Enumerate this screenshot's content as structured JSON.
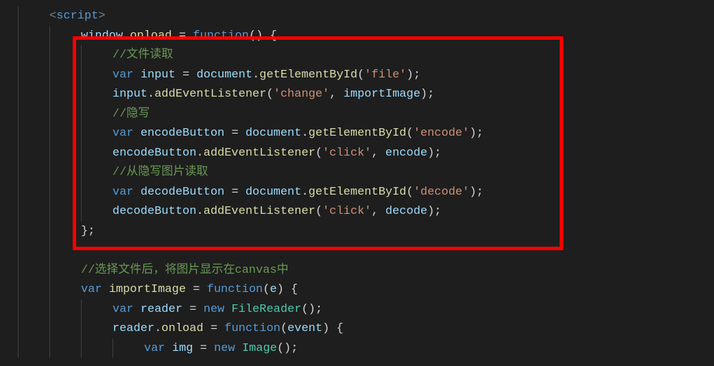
{
  "lines": [
    {
      "indent": 1,
      "tokens": [
        [
          "<",
          "t-angle"
        ],
        [
          "script",
          "t-tag"
        ],
        [
          ">",
          "t-angle"
        ]
      ]
    },
    {
      "indent": 2,
      "tokens": [
        [
          "window",
          "t-obj"
        ],
        [
          ".",
          "t-punc"
        ],
        [
          "onload",
          "t-fn"
        ],
        [
          " ",
          "t-punc"
        ],
        [
          "=",
          "t-punc"
        ],
        [
          " ",
          "t-punc"
        ],
        [
          "function",
          "t-kw"
        ],
        [
          "() {",
          "t-punc"
        ]
      ]
    },
    {
      "indent": 3,
      "tokens": [
        [
          "//文件读取",
          "t-com"
        ]
      ]
    },
    {
      "indent": 3,
      "tokens": [
        [
          "var",
          "t-kw"
        ],
        [
          " ",
          "t-punc"
        ],
        [
          "input",
          "t-var"
        ],
        [
          " ",
          "t-punc"
        ],
        [
          "=",
          "t-punc"
        ],
        [
          " ",
          "t-punc"
        ],
        [
          "document",
          "t-obj"
        ],
        [
          ".",
          "t-punc"
        ],
        [
          "getElementById",
          "t-fn"
        ],
        [
          "(",
          "t-punc"
        ],
        [
          "'file'",
          "t-str"
        ],
        [
          ");",
          "t-punc"
        ]
      ]
    },
    {
      "indent": 3,
      "tokens": [
        [
          "input",
          "t-obj"
        ],
        [
          ".",
          "t-punc"
        ],
        [
          "addEventListener",
          "t-fn"
        ],
        [
          "(",
          "t-punc"
        ],
        [
          "'change'",
          "t-str"
        ],
        [
          ", ",
          "t-punc"
        ],
        [
          "importImage",
          "t-var"
        ],
        [
          ");",
          "t-punc"
        ]
      ]
    },
    {
      "indent": 3,
      "tokens": [
        [
          "//隐写",
          "t-com"
        ]
      ]
    },
    {
      "indent": 3,
      "tokens": [
        [
          "var",
          "t-kw"
        ],
        [
          " ",
          "t-punc"
        ],
        [
          "encodeButton",
          "t-var"
        ],
        [
          " ",
          "t-punc"
        ],
        [
          "=",
          "t-punc"
        ],
        [
          " ",
          "t-punc"
        ],
        [
          "document",
          "t-obj"
        ],
        [
          ".",
          "t-punc"
        ],
        [
          "getElementById",
          "t-fn"
        ],
        [
          "(",
          "t-punc"
        ],
        [
          "'encode'",
          "t-str"
        ],
        [
          ");",
          "t-punc"
        ]
      ]
    },
    {
      "indent": 3,
      "tokens": [
        [
          "encodeButton",
          "t-obj"
        ],
        [
          ".",
          "t-punc"
        ],
        [
          "addEventListener",
          "t-fn"
        ],
        [
          "(",
          "t-punc"
        ],
        [
          "'click'",
          "t-str"
        ],
        [
          ", ",
          "t-punc"
        ],
        [
          "encode",
          "t-var"
        ],
        [
          ");",
          "t-punc"
        ]
      ]
    },
    {
      "indent": 3,
      "tokens": [
        [
          "//从隐写图片读取",
          "t-com"
        ]
      ]
    },
    {
      "indent": 3,
      "tokens": [
        [
          "var",
          "t-kw"
        ],
        [
          " ",
          "t-punc"
        ],
        [
          "decodeButton",
          "t-var"
        ],
        [
          " ",
          "t-punc"
        ],
        [
          "=",
          "t-punc"
        ],
        [
          " ",
          "t-punc"
        ],
        [
          "document",
          "t-obj"
        ],
        [
          ".",
          "t-punc"
        ],
        [
          "getElementById",
          "t-fn"
        ],
        [
          "(",
          "t-punc"
        ],
        [
          "'decode'",
          "t-str"
        ],
        [
          ");",
          "t-punc"
        ]
      ]
    },
    {
      "indent": 3,
      "tokens": [
        [
          "decodeButton",
          "t-obj"
        ],
        [
          ".",
          "t-punc"
        ],
        [
          "addEventListener",
          "t-fn"
        ],
        [
          "(",
          "t-punc"
        ],
        [
          "'click'",
          "t-str"
        ],
        [
          ", ",
          "t-punc"
        ],
        [
          "decode",
          "t-var"
        ],
        [
          ");",
          "t-punc"
        ]
      ]
    },
    {
      "indent": 2,
      "tokens": [
        [
          "};",
          "t-punc"
        ]
      ]
    },
    {
      "indent": 2,
      "tokens": []
    },
    {
      "indent": 2,
      "tokens": [
        [
          "//选择文件后，将图片显示在canvas中",
          "t-com"
        ]
      ]
    },
    {
      "indent": 2,
      "tokens": [
        [
          "var",
          "t-kw"
        ],
        [
          " ",
          "t-punc"
        ],
        [
          "importImage",
          "t-fn"
        ],
        [
          " ",
          "t-punc"
        ],
        [
          "=",
          "t-punc"
        ],
        [
          " ",
          "t-punc"
        ],
        [
          "function",
          "t-kw"
        ],
        [
          "(",
          "t-punc"
        ],
        [
          "e",
          "t-var"
        ],
        [
          ") {",
          "t-punc"
        ]
      ]
    },
    {
      "indent": 3,
      "tokens": [
        [
          "var",
          "t-kw"
        ],
        [
          " ",
          "t-punc"
        ],
        [
          "reader",
          "t-var"
        ],
        [
          " ",
          "t-punc"
        ],
        [
          "=",
          "t-punc"
        ],
        [
          " ",
          "t-punc"
        ],
        [
          "new",
          "t-kw"
        ],
        [
          " ",
          "t-punc"
        ],
        [
          "FileReader",
          "t-cls"
        ],
        [
          "();",
          "t-punc"
        ]
      ]
    },
    {
      "indent": 3,
      "tokens": [
        [
          "reader",
          "t-obj"
        ],
        [
          ".",
          "t-punc"
        ],
        [
          "onload",
          "t-fn"
        ],
        [
          " ",
          "t-punc"
        ],
        [
          "=",
          "t-punc"
        ],
        [
          " ",
          "t-punc"
        ],
        [
          "function",
          "t-kw"
        ],
        [
          "(",
          "t-punc"
        ],
        [
          "event",
          "t-var"
        ],
        [
          ") {",
          "t-punc"
        ]
      ]
    },
    {
      "indent": 4,
      "tokens": [
        [
          "var",
          "t-kw"
        ],
        [
          " ",
          "t-punc"
        ],
        [
          "img",
          "t-var"
        ],
        [
          " ",
          "t-punc"
        ],
        [
          "=",
          "t-punc"
        ],
        [
          " ",
          "t-punc"
        ],
        [
          "new",
          "t-kw"
        ],
        [
          " ",
          "t-punc"
        ],
        [
          "Image",
          "t-cls"
        ],
        [
          "();",
          "t-punc"
        ]
      ]
    }
  ],
  "highlight": {
    "visible": true
  }
}
